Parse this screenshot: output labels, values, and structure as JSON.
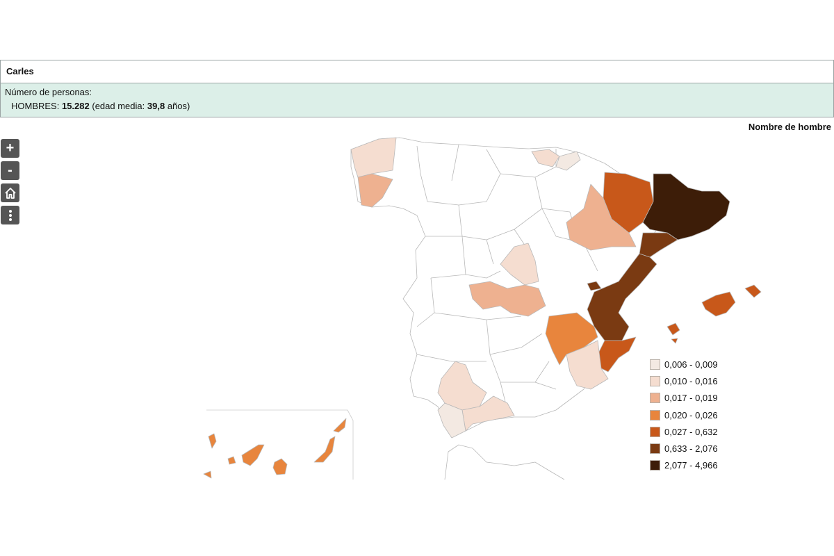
{
  "header": {
    "name": "Carles"
  },
  "stats": {
    "label": "Número de personas:",
    "gender_label": "HOMBRES:",
    "count": "15.282",
    "age_prefix": "(edad media:",
    "age_value": "39,8",
    "age_suffix": "años)"
  },
  "map": {
    "title": "Nombre de hombre",
    "legend": [
      {
        "label": "0,006 - 0,009",
        "color": "#f3e9e2"
      },
      {
        "label": "0,010 - 0,016",
        "color": "#f5ddd0"
      },
      {
        "label": "0,017 - 0,019",
        "color": "#eeb190"
      },
      {
        "label": "0,020 - 0,026",
        "color": "#e8853d"
      },
      {
        "label": "0,027 - 0,632",
        "color": "#c8581a"
      },
      {
        "label": "0,633 - 2,076",
        "color": "#7a3a12"
      },
      {
        "label": "2,077 - 4,966",
        "color": "#3d1d08"
      }
    ],
    "controls": {
      "zoom_in": "+",
      "zoom_out": "-",
      "home_icon": "home-icon",
      "more_icon": "more-vertical-icon"
    }
  }
}
